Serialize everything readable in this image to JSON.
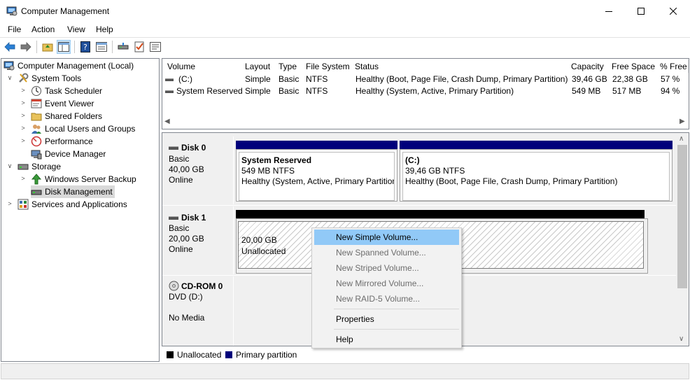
{
  "window": {
    "title": "Computer Management"
  },
  "menu": [
    "File",
    "Action",
    "View",
    "Help"
  ],
  "tree": {
    "root": "Computer Management (Local)",
    "system_tools": "System Tools",
    "task_scheduler": "Task Scheduler",
    "event_viewer": "Event Viewer",
    "shared_folders": "Shared Folders",
    "local_users": "Local Users and Groups",
    "performance": "Performance",
    "device_manager": "Device Manager",
    "storage": "Storage",
    "wsb": "Windows Server Backup",
    "disk_mgmt": "Disk Management",
    "services": "Services and Applications"
  },
  "volume_table": {
    "columns": [
      "Volume",
      "Layout",
      "Type",
      "File System",
      "Status",
      "Capacity",
      "Free Space",
      "% Free"
    ],
    "rows": [
      [
        "(C:)",
        "Simple",
        "Basic",
        "NTFS",
        "Healthy (Boot, Page File, Crash Dump, Primary Partition)",
        "39,46 GB",
        "22,38 GB",
        "57 %"
      ],
      [
        "System Reserved",
        "Simple",
        "Basic",
        "NTFS",
        "Healthy (System, Active, Primary Partition)",
        "549 MB",
        "517 MB",
        "94 %"
      ]
    ]
  },
  "disks": {
    "disk0": {
      "name": "Disk 0",
      "type": "Basic",
      "size": "40,00 GB",
      "status": "Online",
      "sysres": {
        "name": "System Reserved",
        "size": "549 MB NTFS",
        "status": "Healthy (System, Active, Primary Partition)"
      },
      "c": {
        "name": "(C:)",
        "size": "39,46 GB NTFS",
        "status": "Healthy (Boot, Page File, Crash Dump, Primary Partition)"
      }
    },
    "disk1": {
      "name": "Disk 1",
      "type": "Basic",
      "size": "20,00 GB",
      "status": "Online",
      "unalloc": {
        "size": "20,00 GB",
        "label": "Unallocated"
      }
    },
    "cdrom": {
      "name": "CD-ROM 0",
      "type": "DVD (D:)",
      "status": "No Media"
    }
  },
  "legend": {
    "unallocated": "Unallocated",
    "primary": "Primary partition"
  },
  "context_menu": {
    "new_simple": "New Simple Volume...",
    "new_spanned": "New Spanned Volume...",
    "new_striped": "New Striped Volume...",
    "new_mirrored": "New Mirrored Volume...",
    "new_raid5": "New RAID-5 Volume...",
    "properties": "Properties",
    "help": "Help"
  },
  "colors": {
    "primary_partition": "#00007b",
    "unallocated": "#000000",
    "highlight": "#91c9f7"
  }
}
